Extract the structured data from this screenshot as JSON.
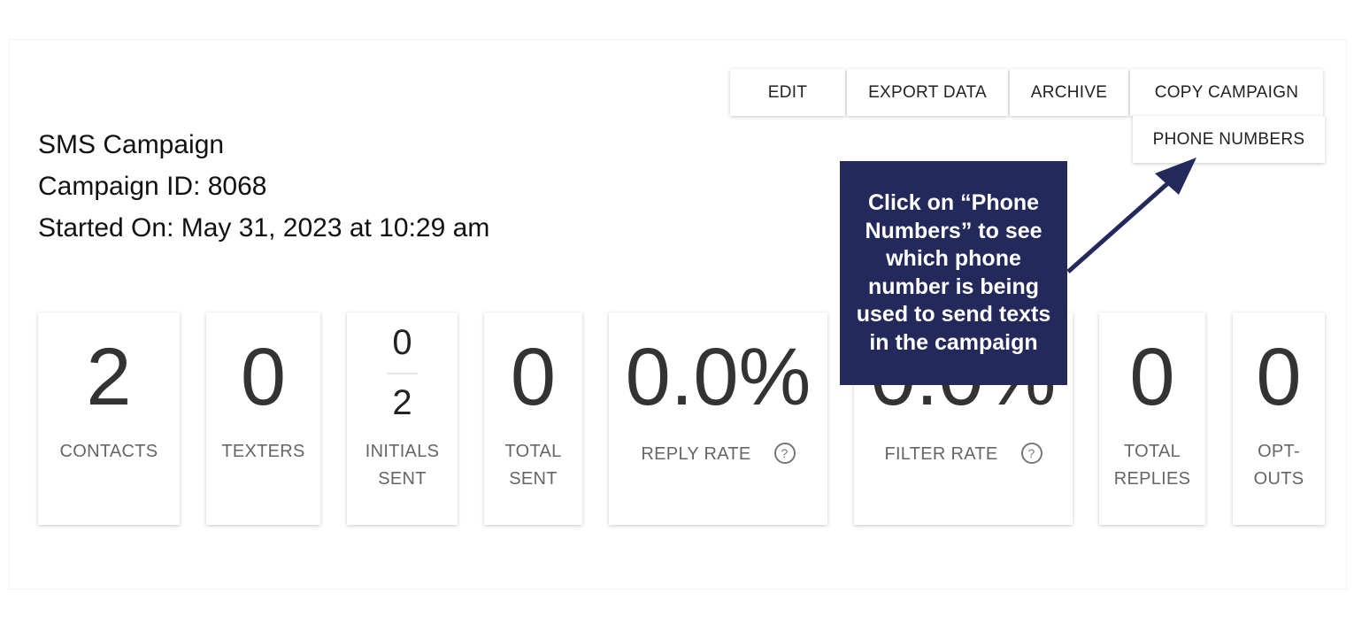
{
  "toolbar": {
    "edit": "EDIT",
    "export": "EXPORT DATA",
    "archive": "ARCHIVE",
    "copy": "COPY CAMPAIGN",
    "phone_numbers": "PHONE NUMBERS"
  },
  "campaign": {
    "type": "SMS Campaign",
    "id_line": "Campaign ID: 8068",
    "started_line": "Started On: May 31, 2023 at 10:29 am"
  },
  "stats": {
    "contacts": {
      "value": "2",
      "label": "CONTACTS"
    },
    "texters": {
      "value": "0",
      "label": "TEXTERS"
    },
    "initials": {
      "numerator": "0",
      "denominator": "2",
      "label_1": "INITIALS",
      "label_2": "SENT"
    },
    "total_sent": {
      "value": "0",
      "label_1": "TOTAL",
      "label_2": "SENT"
    },
    "reply_rate": {
      "value": "0.0%",
      "label": "REPLY RATE"
    },
    "filter_rate": {
      "value": "0.0%",
      "label": "FILTER RATE"
    },
    "total_replies": {
      "value": "0",
      "label_1": "TOTAL",
      "label_2": "REPLIES"
    },
    "opt_outs": {
      "value": "0",
      "label_1": "OPT-",
      "label_2": "OUTS"
    }
  },
  "help_glyph": "?",
  "callout": {
    "text": "Click on “Phone Numbers” to see which phone number is being used to send texts in the campaign",
    "color": "#23295a"
  }
}
